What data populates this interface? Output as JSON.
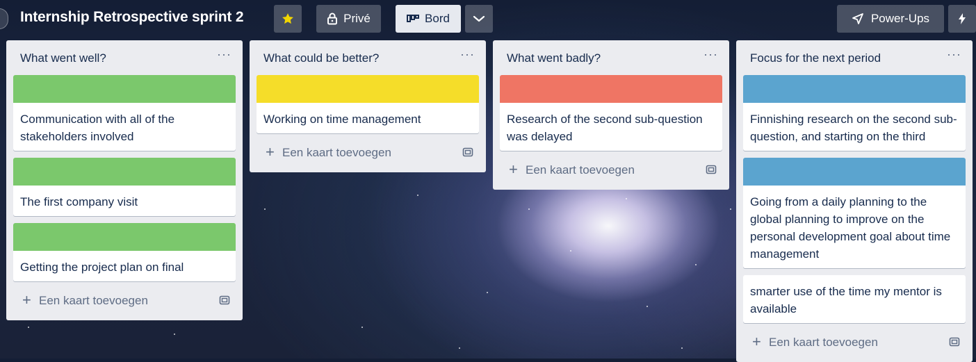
{
  "board": {
    "title": "Internship Retrospective sprint 2",
    "star_icon": "star-icon",
    "visibility_label": "Privé",
    "view_label": "Bord",
    "powerups_label": "Power-Ups",
    "colors": {
      "star": "#f2d600",
      "board_view_bg": "#e6e9ef"
    }
  },
  "lists": [
    {
      "title": "What went well?",
      "menu": "···",
      "add_label": "Een kaart toevoegen",
      "cards": [
        {
          "cover": "#7bc86c",
          "text": "Communication with all of the stakeholders involved"
        },
        {
          "cover": "#7bc86c",
          "text": "The first company visit"
        },
        {
          "cover": "#7bc86c",
          "text": "Getting the project plan on final"
        }
      ]
    },
    {
      "title": "What could be better?",
      "menu": "···",
      "add_label": "Een kaart toevoegen",
      "cards": [
        {
          "cover": "#f5dd29",
          "text": "Working on time management"
        }
      ]
    },
    {
      "title": "What went badly?",
      "menu": "···",
      "add_label": "Een kaart toevoegen",
      "cards": [
        {
          "cover": "#ef7564",
          "text": "Research of the second sub-question was delayed"
        }
      ]
    },
    {
      "title": "Focus for the next period",
      "menu": "···",
      "add_label": "Een kaart toevoegen",
      "cards": [
        {
          "cover": "#5ba4cf",
          "text": "Finnishing research on the second sub-question, and starting on the third"
        },
        {
          "cover": "#5ba4cf",
          "text": "Going from a daily planning to the global planning to improve on the personal development goal about time management"
        },
        {
          "cover": null,
          "text": "smarter use of the time my mentor is available"
        }
      ]
    }
  ]
}
